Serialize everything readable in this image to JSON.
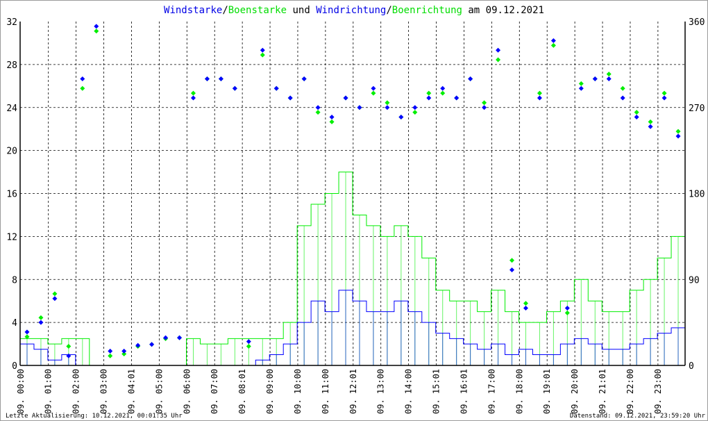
{
  "chart_data": {
    "type": "line",
    "title_parts": [
      {
        "text": "Windstarke",
        "color": "#0000e6"
      },
      {
        "text": "/",
        "color": "#000000"
      },
      {
        "text": "Boenstarke",
        "color": "#00dd00"
      },
      {
        "text": " und ",
        "color": "#000000"
      },
      {
        "text": "Windrichtung",
        "color": "#0000e6"
      },
      {
        "text": "/",
        "color": "#000000"
      },
      {
        "text": "Boenrichtung",
        "color": "#00dd00"
      },
      {
        "text": " am 09.12.2021",
        "color": "#000000"
      }
    ],
    "x_unit": "hour of day (half-hour resolution, approximate)",
    "xlim": [
      0,
      24
    ],
    "ylim_left": [
      0,
      32
    ],
    "yticks_left": [
      "0",
      "4",
      "8",
      "12",
      "16",
      "20",
      "24",
      "28",
      "32"
    ],
    "ylim_right": [
      0,
      360
    ],
    "yticks_right": [
      "0",
      "90",
      "180",
      "270",
      "360"
    ],
    "xtick_labels": [
      "09. 00:00",
      "09. 01:00",
      "09. 02:00",
      "09. 03:00",
      "09. 04:01",
      "09. 05:00",
      "09. 06:00",
      "09. 07:00",
      "09. 08:01",
      "09. 09:00",
      "09. 10:00",
      "09. 11:00",
      "09. 12:01",
      "09. 13:00",
      "09. 14:00",
      "09. 15:01",
      "09. 16:01",
      "09. 17:00",
      "09. 18:00",
      "09. 19:01",
      "09. 20:00",
      "09. 21:01",
      "09. 22:00",
      "09. 23:00"
    ],
    "grid": true,
    "series": [
      {
        "name": "Boenstarke",
        "axis": "left",
        "color": "#00ee00",
        "kind": "step",
        "values": [
          2.5,
          2.5,
          2,
          2.5,
          2.5,
          0,
          0,
          0,
          0,
          0,
          0,
          0,
          2.5,
          2,
          2,
          2.5,
          2.5,
          2.5,
          2.5,
          4,
          13,
          15,
          16,
          18,
          14,
          13,
          12,
          13,
          12,
          10,
          7,
          6,
          6,
          5,
          7,
          5,
          4,
          4,
          5,
          6,
          8,
          6,
          5,
          5,
          7,
          8,
          10,
          12
        ]
      },
      {
        "name": "Windstarke",
        "axis": "left",
        "color": "#0000ff",
        "kind": "step",
        "values": [
          2,
          1.5,
          0.5,
          1,
          0,
          0,
          0,
          0,
          0,
          0,
          0,
          0,
          0,
          0,
          0,
          0,
          0,
          0.5,
          1,
          2,
          4,
          6,
          5,
          7,
          6,
          5,
          5,
          6,
          5,
          4,
          3,
          2.5,
          2,
          1.5,
          2,
          1,
          1.5,
          1,
          1,
          2,
          2.5,
          2,
          1.5,
          1.5,
          2,
          2.5,
          3,
          3.5
        ]
      },
      {
        "name": "Boenrichtung",
        "axis": "right",
        "color": "#00ee00",
        "kind": "scatter",
        "values": [
          30,
          50,
          75,
          20,
          290,
          350,
          10,
          12,
          20,
          22,
          28,
          29,
          285,
          300,
          300,
          290,
          20,
          325,
          290,
          280,
          300,
          265,
          255,
          280,
          270,
          285,
          275,
          260,
          265,
          285,
          285,
          280,
          300,
          275,
          320,
          110,
          65,
          285,
          335,
          55,
          295,
          300,
          305,
          290,
          265,
          255,
          285,
          245
        ]
      },
      {
        "name": "Windrichtung",
        "axis": "right",
        "color": "#0000ff",
        "kind": "scatter",
        "values": [
          35,
          45,
          70,
          10,
          300,
          355,
          15,
          15,
          21,
          22,
          29,
          29,
          280,
          300,
          300,
          290,
          25,
          330,
          290,
          280,
          300,
          270,
          260,
          280,
          270,
          290,
          270,
          260,
          270,
          280,
          290,
          280,
          300,
          270,
          330,
          100,
          60,
          280,
          340,
          60,
          290,
          300,
          300,
          280,
          260,
          250,
          280,
          240
        ]
      }
    ]
  },
  "footer": {
    "left": "Letzte Aktualisierung: 10.12.2021, 00:01:35 Uhr",
    "right": "Datenstand: 09.12.2021, 23:59:20 Uhr"
  }
}
